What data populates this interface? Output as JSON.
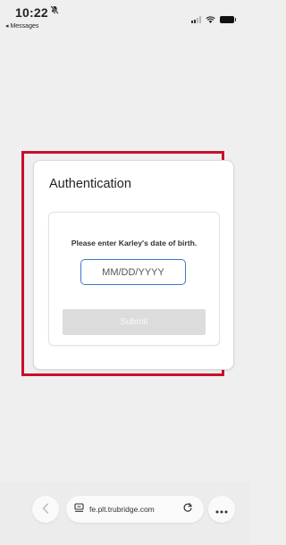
{
  "status_bar": {
    "time": "10:22",
    "back_app": "◂ Messages"
  },
  "auth": {
    "title": "Authentication",
    "prompt": "Please enter Karley's date of birth.",
    "dob_placeholder": "MM/DD/YYYY",
    "dob_value": "",
    "submit_label": "Submit"
  },
  "browser": {
    "url": "fe.plt.trubridge.com"
  },
  "colors": {
    "highlight": "#c8102e",
    "input_focus": "#3f74d4",
    "submit_disabled": "#dcdcdc"
  },
  "icons": [
    "bell-slash-icon",
    "signal-icon",
    "wifi-icon",
    "battery-icon",
    "chevron-left-icon",
    "page-icon",
    "reload-icon",
    "more-icon"
  ]
}
